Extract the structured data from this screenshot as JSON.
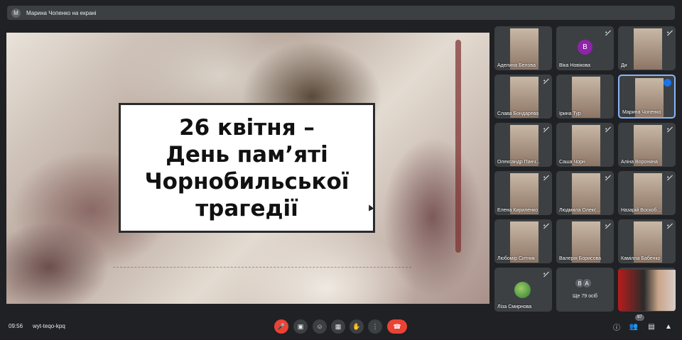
{
  "top_bar": {
    "avatar_letter": "M",
    "presenting_text": "Марина Чопенко на екрані"
  },
  "slide": {
    "lines": [
      "26 квітня –",
      "День пам’яті",
      "Чорнобильської",
      "трагедії"
    ]
  },
  "participants": [
    {
      "name": "Аделина Белова",
      "muted": false,
      "kind": "camera"
    },
    {
      "name": "Віка Новікова",
      "muted": true,
      "kind": "avatar",
      "avatar_letter": "В",
      "avatar_color": "#8e24aa"
    },
    {
      "name": "Ди",
      "muted": true,
      "kind": "camera"
    },
    {
      "name": "Слава Бондарева",
      "muted": true,
      "kind": "camera"
    },
    {
      "name": "Ірина Тур",
      "muted": false,
      "kind": "camera"
    },
    {
      "name": "Марина Чопенко",
      "muted": false,
      "kind": "camera",
      "speaking": true
    },
    {
      "name": "Олександр Панч...",
      "muted": true,
      "kind": "camera"
    },
    {
      "name": "Саша Чорн",
      "muted": true,
      "kind": "camera"
    },
    {
      "name": "Аліна Воронина",
      "muted": true,
      "kind": "camera"
    },
    {
      "name": "Елена Кириленко",
      "muted": true,
      "kind": "camera"
    },
    {
      "name": "Людмила Олекс...",
      "muted": true,
      "kind": "camera"
    },
    {
      "name": "Назарій Воскоб...",
      "muted": true,
      "kind": "camera"
    },
    {
      "name": "Любомір Ситник",
      "muted": true,
      "kind": "camera"
    },
    {
      "name": "Валерія Борисова",
      "muted": true,
      "kind": "camera"
    },
    {
      "name": "Камілла Бабенко",
      "muted": true,
      "kind": "camera"
    },
    {
      "name": "Ліза Смирнова",
      "muted": true,
      "kind": "avatar-photo"
    },
    {
      "name": "Ще 79 осіб",
      "muted": false,
      "kind": "more",
      "stack_letters": [
        "В",
        "А"
      ]
    },
    {
      "name": "",
      "muted": false,
      "kind": "camera-self"
    }
  ],
  "bottom_bar": {
    "time": "09:56",
    "meeting_code": "wyt-teqo-kpq",
    "participants_count": "97",
    "controls": [
      "mic-off-icon",
      "camera-icon",
      "emoji-icon",
      "present-icon",
      "raise-hand-icon",
      "more-options-icon",
      "end-call-icon"
    ],
    "right_icons": [
      "info-icon",
      "people-icon",
      "chat-icon",
      "activities-icon"
    ],
    "colors": {
      "end_call": "#ea4335",
      "muted_mic": "#ea4335",
      "speaking": "#1a73e8"
    }
  }
}
